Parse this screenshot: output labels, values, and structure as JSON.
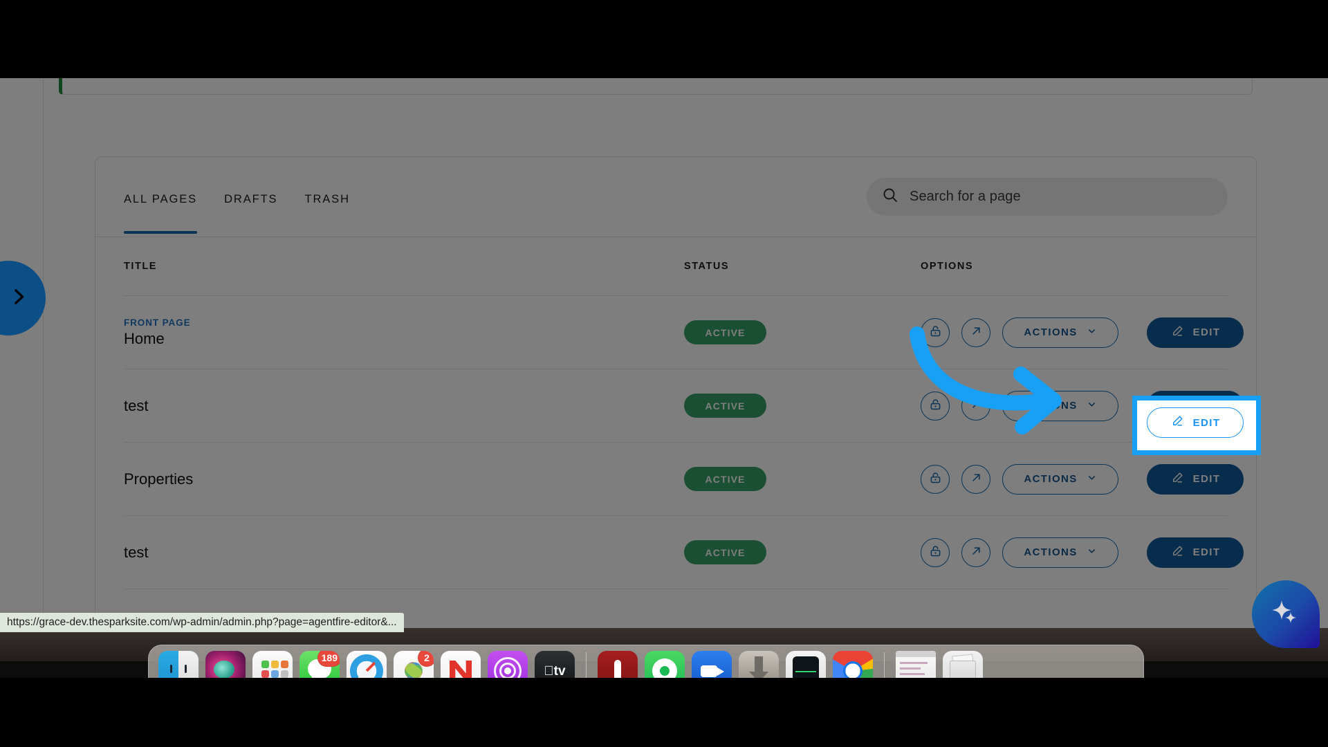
{
  "browser": {
    "status_url": "https://grace-dev.thesparksite.com/wp-admin/admin.php?page=agentfire-editor&..."
  },
  "card": {
    "tabs": [
      {
        "label": "ALL PAGES",
        "active": true
      },
      {
        "label": "DRAFTS",
        "active": false
      },
      {
        "label": "TRASH",
        "active": false
      }
    ],
    "search": {
      "placeholder": "Search for a page",
      "icon": "search-icon"
    },
    "columns": {
      "title": "TITLE",
      "status": "STATUS",
      "options": "OPTIONS"
    },
    "row_actions": {
      "lock_icon": "lock-icon",
      "open_icon": "external-link-icon",
      "actions_label": "ACTIONS",
      "actions_caret": "chevron-down-icon",
      "edit_label": "EDIT",
      "edit_icon": "pencil-icon"
    },
    "rows": [
      {
        "front_tag": "FRONT PAGE",
        "title": "Home",
        "status": "ACTIVE",
        "highlighted": false
      },
      {
        "front_tag": "",
        "title": "test",
        "status": "ACTIVE",
        "highlighted": true
      },
      {
        "front_tag": "",
        "title": "Properties",
        "status": "ACTIVE",
        "highlighted": false
      },
      {
        "front_tag": "",
        "title": "test",
        "status": "ACTIVE",
        "highlighted": false
      }
    ]
  },
  "side_nav": {
    "icon": "chevron-right-icon"
  },
  "ai_bubble": {
    "icon": "sparkles-icon"
  },
  "annotation": {
    "arrow_color": "#18a0f7",
    "highlight_color": "#18a0f7"
  },
  "colors": {
    "accent_blue": "#10599b",
    "tab_underline": "#1668ad",
    "status_green": "#37a169",
    "front_tag_blue": "#2272c0",
    "highlight": "#18a0f7"
  },
  "dock": {
    "items": [
      {
        "name": "finder",
        "badge": ""
      },
      {
        "name": "siri",
        "badge": ""
      },
      {
        "name": "launchpad",
        "badge": ""
      },
      {
        "name": "messages",
        "badge": "189"
      },
      {
        "name": "safari",
        "badge": ""
      },
      {
        "name": "photos",
        "badge": "2"
      },
      {
        "name": "notes",
        "badge": ""
      },
      {
        "name": "podcasts",
        "badge": ""
      },
      {
        "name": "apple-tv",
        "badge": ""
      },
      {
        "name": "separator",
        "badge": ""
      },
      {
        "name": "red-app",
        "badge": ""
      },
      {
        "name": "spotify",
        "badge": ""
      },
      {
        "name": "zoom",
        "badge": ""
      },
      {
        "name": "downloads",
        "badge": ""
      },
      {
        "name": "activity-monitor",
        "badge": ""
      },
      {
        "name": "chrome",
        "badge": ""
      },
      {
        "name": "separator",
        "badge": ""
      },
      {
        "name": "window-preview",
        "badge": ""
      },
      {
        "name": "trash",
        "badge": ""
      }
    ]
  }
}
